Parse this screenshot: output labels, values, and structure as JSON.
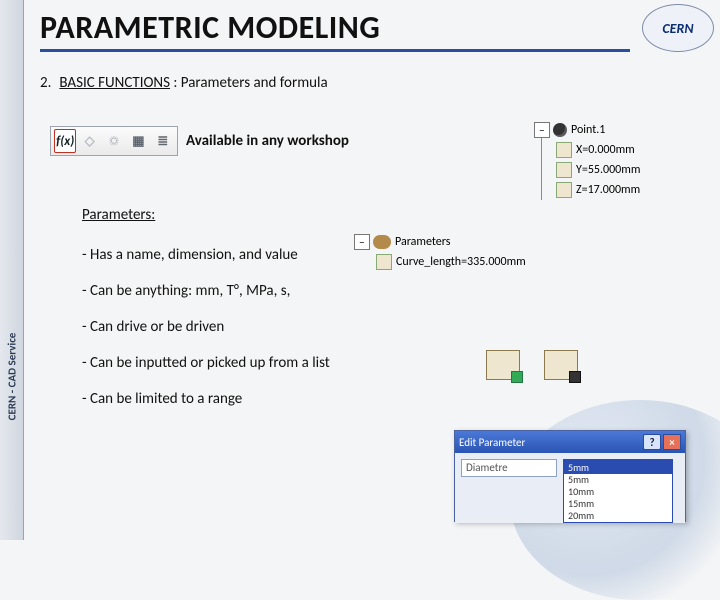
{
  "brand": {
    "rail_text": "CERN - CAD Service",
    "logo_text": "CERN"
  },
  "title": "PARAMETRIC MODELING",
  "section": {
    "number": "2.",
    "label": "BASIC FUNCTIONS",
    "rest": " : Parameters and formula"
  },
  "toolbar": {
    "caption": "Available in any workshop",
    "buttons": [
      {
        "glyph": "f(x)",
        "name": "formula-button",
        "selected": true
      },
      {
        "glyph": "◇",
        "name": "design-table-button"
      },
      {
        "glyph": "☼",
        "name": "law-button"
      },
      {
        "glyph": "▦",
        "name": "rules-button"
      },
      {
        "glyph": "≣",
        "name": "checks-button"
      }
    ]
  },
  "body": {
    "header": "Parameters:",
    "lines": [
      "- Has a name, dimension, and value",
      "- Can be anything: mm, T°, MPa, s,",
      "- Can drive or be driven",
      "- Can be inputted or picked up from a list",
      "- Can be limited to a range"
    ]
  },
  "tree_point": {
    "root": "Point.1",
    "children": [
      "X=0.000mm",
      "Y=55.000mm",
      "Z=17.000mm"
    ]
  },
  "tree_params": {
    "root": "Parameters",
    "children": [
      "Curve_length=335.000mm"
    ]
  },
  "dialog": {
    "title": "Edit Parameter",
    "field_name": "Diametre",
    "current_value": "5mm",
    "options": [
      "5mm",
      "10mm",
      "15mm",
      "20mm"
    ]
  }
}
